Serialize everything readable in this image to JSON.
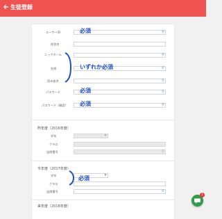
{
  "header": {
    "back_icon": "arrow-left-icon",
    "title": "生徒登録",
    "color": "#ef5350"
  },
  "form": {
    "fields": [
      {
        "label": "ユーザーID",
        "note": "必須"
      },
      {
        "label": "校舎名",
        "note": ""
      },
      {
        "label": "ニックネーム",
        "note": ""
      },
      {
        "label": "名前",
        "note": "いずれか必須"
      },
      {
        "label": "読み仮名",
        "note": ""
      },
      {
        "label": "パスワード",
        "note": "必須"
      },
      {
        "label": "パスワード（確認）",
        "note": "必須"
      }
    ],
    "prev_year": {
      "title": "昨年度（2016年度）",
      "grade_label": "学年",
      "class_label": "クラス",
      "number_label": "出席番号"
    },
    "this_year": {
      "title": "今年度（2017年度）",
      "grade_label": "学年",
      "class_label": "クラス",
      "number_label": "出席番号",
      "note": "必須"
    },
    "next_year": {
      "title": "来年度（2018年度）"
    }
  },
  "chat": {
    "icon": "chat-icon",
    "badge": "1",
    "color": "#2e9e48"
  },
  "annotation_color": "#1e4fc6"
}
